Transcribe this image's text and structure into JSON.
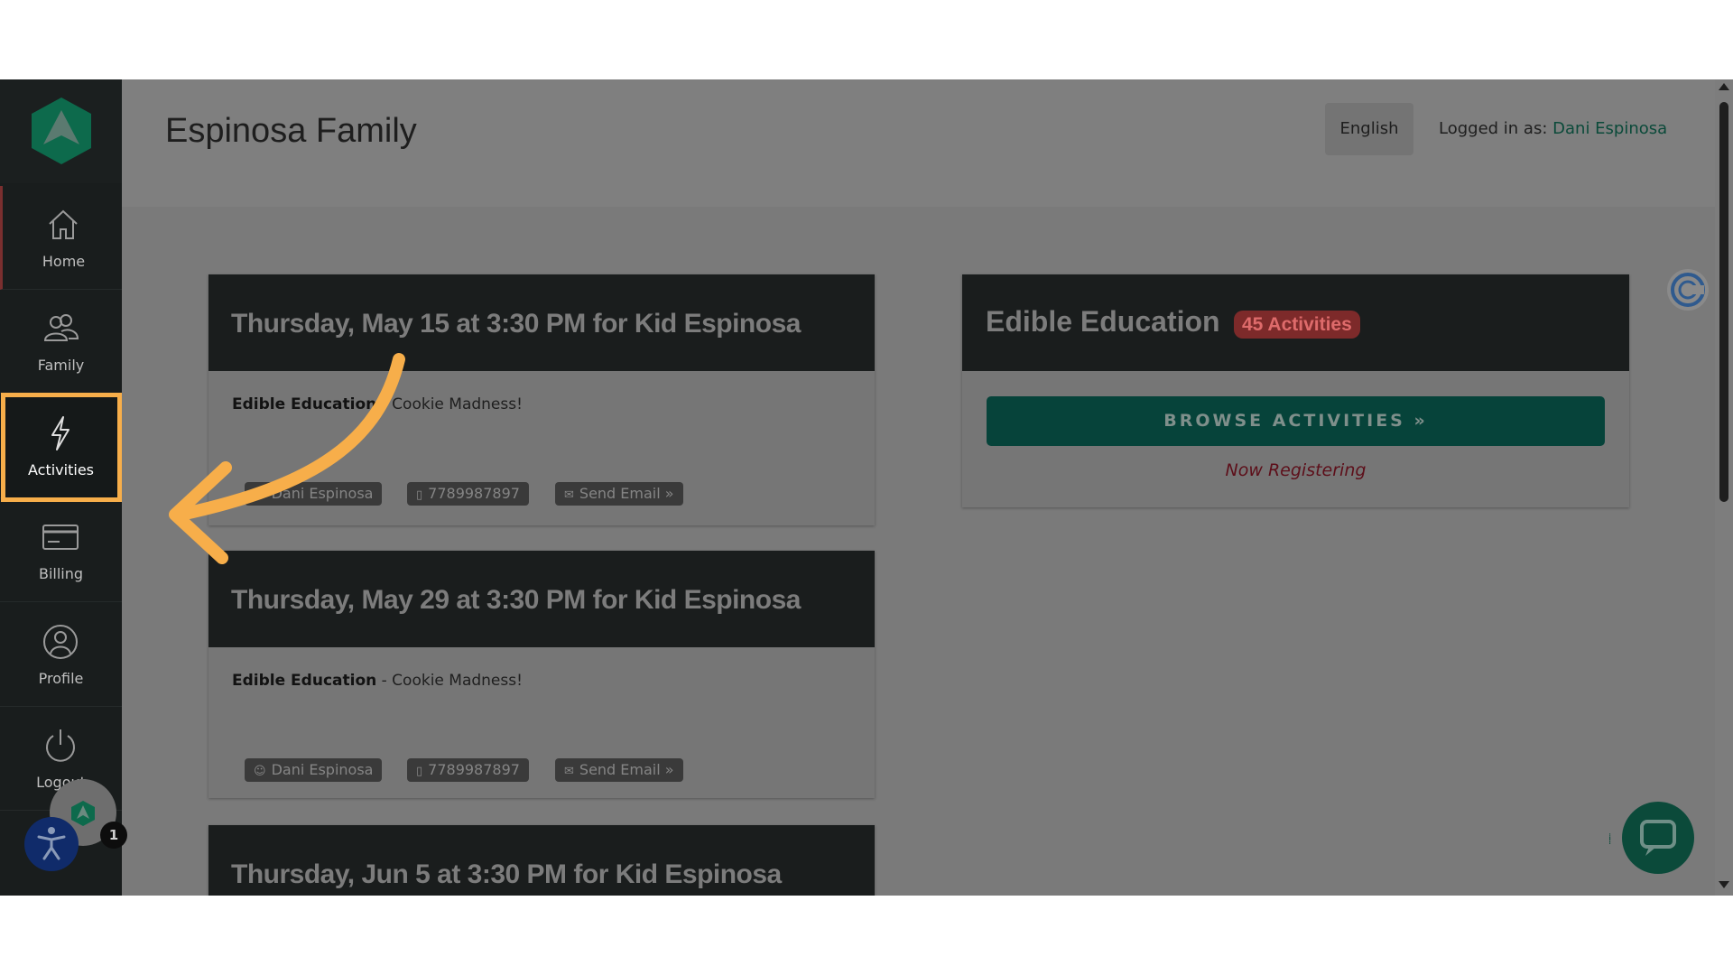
{
  "header": {
    "title": "Espinosa Family",
    "language_button": "English",
    "logged_in_label": "Logged in as:",
    "logged_in_user": "Dani Espinosa"
  },
  "sidebar": {
    "items": [
      {
        "label": "Home",
        "icon": "home-icon"
      },
      {
        "label": "Family",
        "icon": "family-icon"
      },
      {
        "label": "Activities",
        "icon": "lightning-icon"
      },
      {
        "label": "Billing",
        "icon": "credit-card-icon"
      },
      {
        "label": "Profile",
        "icon": "user-icon"
      },
      {
        "label": "Logout",
        "icon": "power-icon"
      }
    ]
  },
  "events": [
    {
      "title": "Thursday, May 15 at 3:30 PM for Kid Espinosa",
      "program": "Edible Education",
      "activity": " - Cookie Madness!",
      "contact_name": "Dani Espinosa",
      "phone": "7789987897",
      "email_label": "Send Email »"
    },
    {
      "title": "Thursday, May 29 at 3:30 PM for Kid Espinosa",
      "program": "Edible Education",
      "activity": " - Cookie Madness!",
      "contact_name": "Dani Espinosa",
      "phone": "7789987897",
      "email_label": "Send Email »"
    },
    {
      "title": "Thursday, Jun 5 at 3:30 PM for Kid Espinosa"
    }
  ],
  "panel": {
    "title": "Edible Education",
    "badge": "45 Activities",
    "browse_button": "BROWSE ACTIVITIES »",
    "status": "Now Registering"
  },
  "widgets": {
    "notification_count": "1"
  },
  "colors": {
    "accent_green": "#0b4a3a",
    "highlight_orange": "#f7ae4a",
    "badge_red": "#7d2a2a",
    "sidebar_bg": "#191d1d"
  }
}
